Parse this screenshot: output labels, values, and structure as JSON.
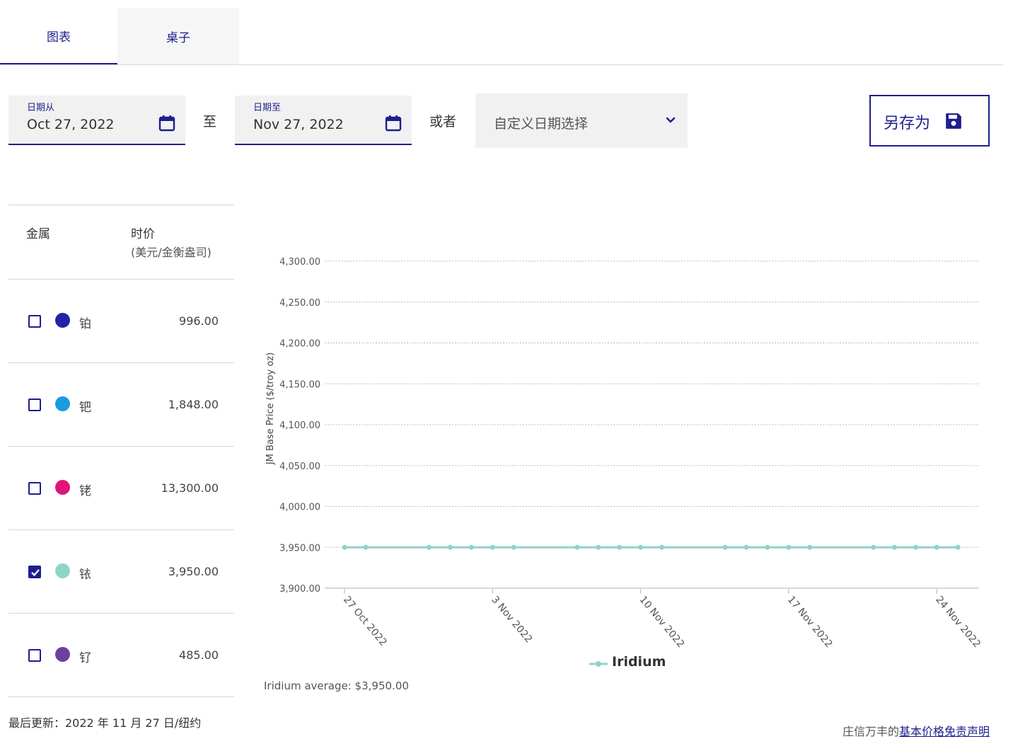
{
  "tabs": [
    {
      "label": "图表"
    },
    {
      "label": "桌子"
    }
  ],
  "filters": {
    "from_label": "日期从",
    "from_value": "Oct 27, 2022",
    "to_word": "至",
    "to_label": "日期至",
    "to_value": "Nov 27, 2022",
    "or_word": "或者",
    "custom_select": "自定义日期选择",
    "save_as": "另存为"
  },
  "table": {
    "col_metal": "金属",
    "col_price": "时价",
    "col_unit": "(美元/金衡盎司)",
    "rows": [
      {
        "name": "铂",
        "price": "996.00",
        "color": "#2323a8",
        "checked": false
      },
      {
        "name": "钯",
        "price": "1,848.00",
        "color": "#1a9be0",
        "checked": false
      },
      {
        "name": "铑",
        "price": "13,300.00",
        "color": "#e0157a",
        "checked": false
      },
      {
        "name": "铱",
        "price": "3,950.00",
        "color": "#8fd4c8",
        "checked": true
      },
      {
        "name": "钌",
        "price": "485.00",
        "color": "#6e3f9e",
        "checked": false
      }
    ]
  },
  "footer": {
    "updated": "最后更新：2022 年 11 月 27 日/纽约",
    "disclaimer_prefix": "庄信万丰的",
    "disclaimer_link": "基本价格免责声明"
  },
  "chart_data": {
    "type": "line",
    "ylabel": "JM Base Price ($/troy oz)",
    "ylim": [
      3900,
      4300
    ],
    "yticks": [
      "4,300.00",
      "4,250.00",
      "4,200.00",
      "4,150.00",
      "4,100.00",
      "4,050.00",
      "4,000.00",
      "3,950.00",
      "3,900.00"
    ],
    "xticks": [
      "27 Oct 2022",
      "3 Nov 2022",
      "10 Nov 2022",
      "17 Nov 2022",
      "24 Nov 2022"
    ],
    "x": [
      "2022-10-27",
      "2022-10-28",
      "2022-10-31",
      "2022-11-01",
      "2022-11-02",
      "2022-11-03",
      "2022-11-04",
      "2022-11-07",
      "2022-11-08",
      "2022-11-09",
      "2022-11-10",
      "2022-11-11",
      "2022-11-14",
      "2022-11-15",
      "2022-11-16",
      "2022-11-17",
      "2022-11-18",
      "2022-11-21",
      "2022-11-22",
      "2022-11-23",
      "2022-11-24",
      "2022-11-25"
    ],
    "series": [
      {
        "name": "Iridium",
        "color": "#8fd4c8",
        "values": [
          3950,
          3950,
          3950,
          3950,
          3950,
          3950,
          3950,
          3950,
          3950,
          3950,
          3950,
          3950,
          3950,
          3950,
          3950,
          3950,
          3950,
          3950,
          3950,
          3950,
          3950,
          3950
        ]
      }
    ],
    "grid": true,
    "legend": "bottom",
    "average_text": "Iridium average: $3,950.00"
  }
}
